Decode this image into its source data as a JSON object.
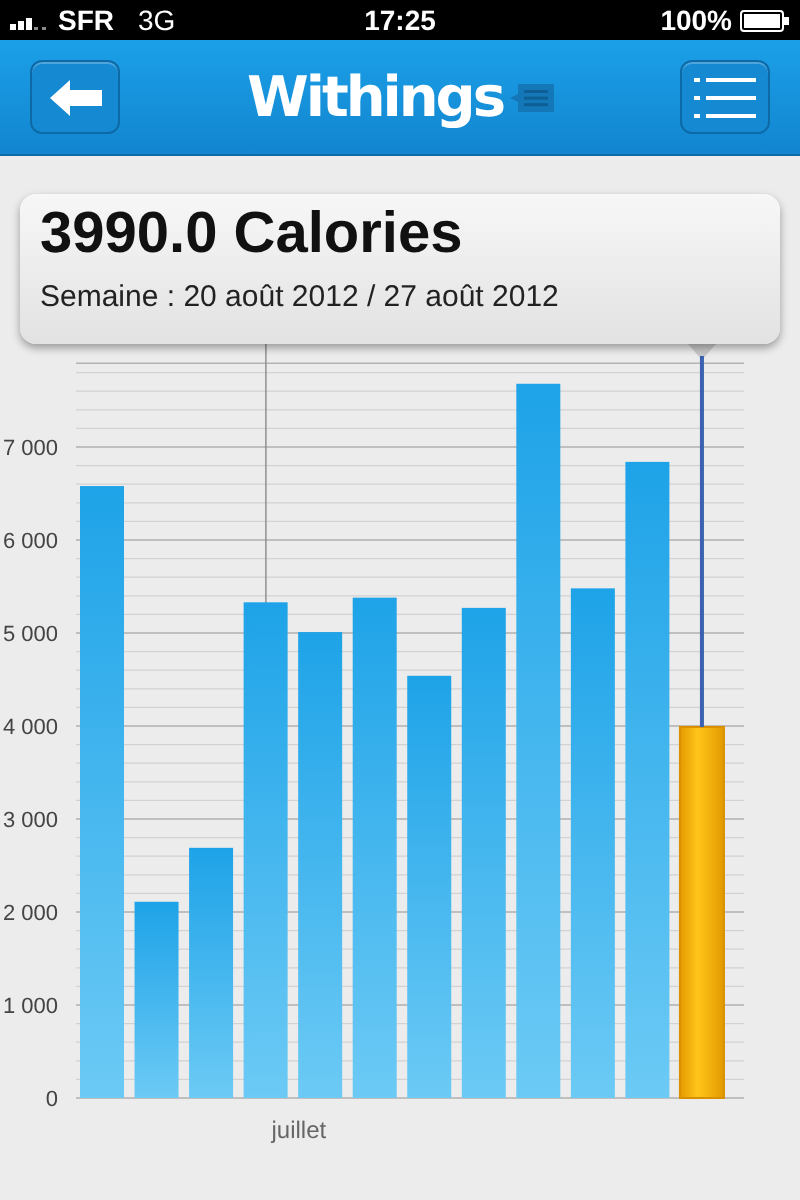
{
  "status_bar": {
    "carrier": "SFR",
    "network": "3G",
    "time": "17:25",
    "battery": "100%"
  },
  "nav_bar": {
    "title": "Withings"
  },
  "tooltip": {
    "value": "3990.0 Calories",
    "period": "Semaine : 20 août 2012 / 27 août 2012"
  },
  "chart": {
    "chart_data": {
      "type": "bar",
      "grid": true,
      "ylim": [
        0,
        7900
      ],
      "yticks": [
        {
          "value": 0,
          "label": "0"
        },
        {
          "value": 1000,
          "label": "1 000"
        },
        {
          "value": 2000,
          "label": "2 000"
        },
        {
          "value": 3000,
          "label": "3 000"
        },
        {
          "value": 4000,
          "label": "4 000"
        },
        {
          "value": 5000,
          "label": "5 000"
        },
        {
          "value": 6000,
          "label": "6 000"
        },
        {
          "value": 7000,
          "label": "7 000"
        }
      ],
      "values": [
        6580,
        2110,
        2690,
        5330,
        5010,
        5380,
        4540,
        5270,
        7680,
        5480,
        6840,
        3990
      ]
    },
    "month_label": "juillet",
    "bars": [
      {
        "selected": false
      },
      {
        "selected": false
      },
      {
        "selected": false
      },
      {
        "selected": false
      },
      {
        "selected": false
      },
      {
        "selected": false
      },
      {
        "selected": false
      },
      {
        "selected": false
      },
      {
        "selected": false
      },
      {
        "selected": false
      },
      {
        "selected": false
      },
      {
        "selected": true
      }
    ]
  }
}
